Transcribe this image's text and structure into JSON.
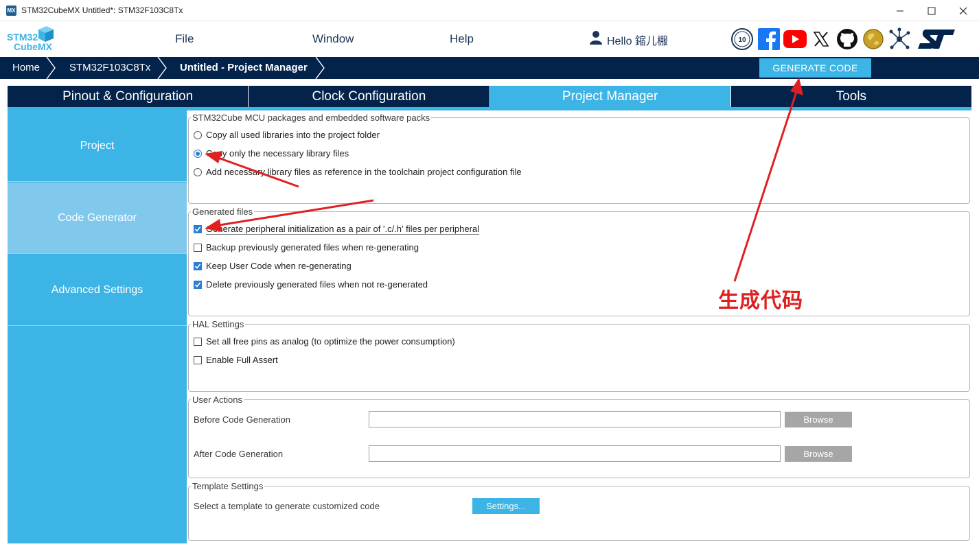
{
  "window": {
    "app_icon": "MX",
    "title": "STM32CubeMX Untitled*: STM32F103C8Tx",
    "controls": [
      "minimize-icon",
      "maximize-icon",
      "close-icon"
    ]
  },
  "logo": {
    "line1": "STM32",
    "line2": "CubeMX"
  },
  "menu": {
    "items": [
      "File",
      "Window",
      "Help"
    ],
    "user_greeting": "Hello 鏥儿棴"
  },
  "social_icons": [
    "anniversary-badge-icon",
    "facebook-icon",
    "youtube-icon",
    "x-icon",
    "github-icon",
    "community-icon",
    "network-icon",
    "st-logo-icon"
  ],
  "breadcrumb": [
    "Home",
    "STM32F103C8Tx",
    "Untitled - Project Manager"
  ],
  "generate_button": "GENERATE CODE",
  "tabs": [
    "Pinout & Configuration",
    "Clock Configuration",
    "Project Manager",
    "Tools"
  ],
  "active_tab": "Project Manager",
  "sidebar": {
    "items": [
      "Project",
      "Code Generator",
      "Advanced Settings"
    ],
    "active": "Code Generator"
  },
  "mcu_packages": {
    "title": "STM32Cube MCU packages and embedded software packs",
    "options": [
      {
        "label": "Copy all used libraries into the project folder",
        "selected": false
      },
      {
        "label": "Copy only the necessary library files",
        "selected": true
      },
      {
        "label": "Add necessary library files as reference in the toolchain project configuration file",
        "selected": false
      }
    ]
  },
  "generated_files": {
    "title": "Generated files",
    "options": [
      {
        "label": "Generate peripheral initialization as a pair of '.c/.h' files per peripheral",
        "checked": true
      },
      {
        "label": "Backup previously generated files when re-generating",
        "checked": false
      },
      {
        "label": "Keep User Code when re-generating",
        "checked": true
      },
      {
        "label": "Delete previously generated files when not re-generated",
        "checked": true
      }
    ]
  },
  "hal_settings": {
    "title": "HAL Settings",
    "options": [
      {
        "label": "Set all free pins as analog (to optimize the power consumption)",
        "checked": false
      },
      {
        "label": "Enable Full Assert",
        "checked": false
      }
    ]
  },
  "user_actions": {
    "title": "User Actions",
    "before_label": "Before Code Generation",
    "before_value": "",
    "after_label": "After Code Generation",
    "after_value": "",
    "browse_label": "Browse"
  },
  "template_settings": {
    "title": "Template Settings",
    "label": "Select a template to generate customized code",
    "button": "Settings..."
  },
  "annotation": {
    "text": "生成代码",
    "color": "#e02020"
  },
  "colors": {
    "navy": "#03234b",
    "accent": "#3cb4e6",
    "sidebar_active": "#80c8ec"
  }
}
